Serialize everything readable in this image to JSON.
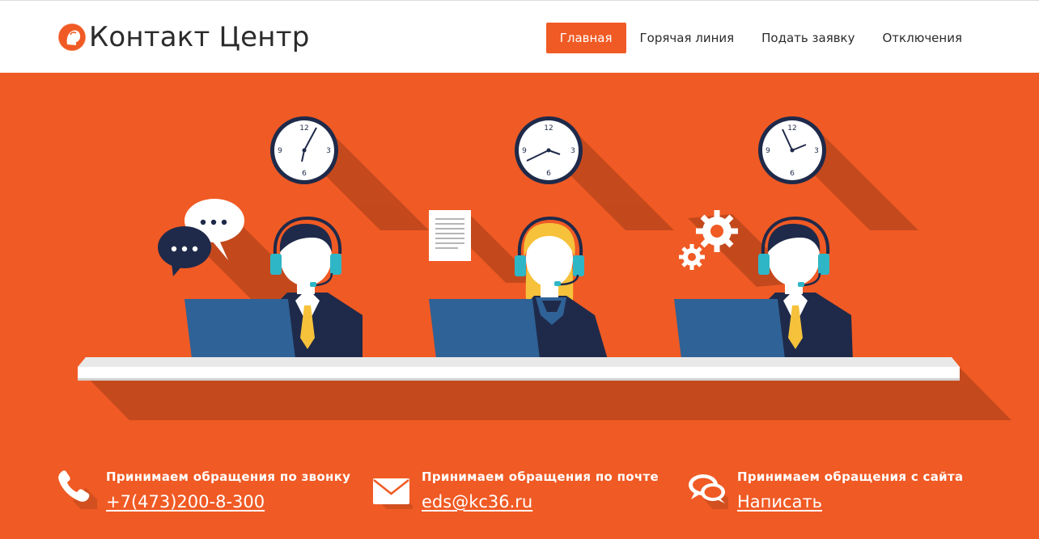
{
  "header": {
    "logo_text": "Контакт Центр",
    "nav": [
      {
        "label": "Главная",
        "active": true
      },
      {
        "label": "Горячая линия",
        "active": false
      },
      {
        "label": "Подать заявку",
        "active": false
      },
      {
        "label": "Отключения",
        "active": false
      }
    ]
  },
  "hero": {
    "clocks": [
      {
        "label_12": "12",
        "label_3": "3",
        "label_6": "6",
        "label_9": "9"
      },
      {
        "label_12": "12",
        "label_3": "3",
        "label_6": "6",
        "label_9": "9"
      },
      {
        "label_12": "12",
        "label_3": "3",
        "label_6": "6",
        "label_9": "9"
      }
    ]
  },
  "contacts": [
    {
      "title": "Принимаем обращения по звонку",
      "link": "+7(473)200-8-300",
      "icon": "phone-icon"
    },
    {
      "title": "Принимаем обращения по почте",
      "link": "eds@kc36.ru",
      "icon": "envelope-icon"
    },
    {
      "title": "Принимаем обращения с сайта",
      "link": "Написать",
      "icon": "chat-bubbles-icon"
    }
  ],
  "colors": {
    "accent": "#f05a24",
    "navy": "#1f2a4a",
    "laptop": "#2f6296",
    "headset": "#2fb6c6",
    "tie": "#f6c23b"
  }
}
